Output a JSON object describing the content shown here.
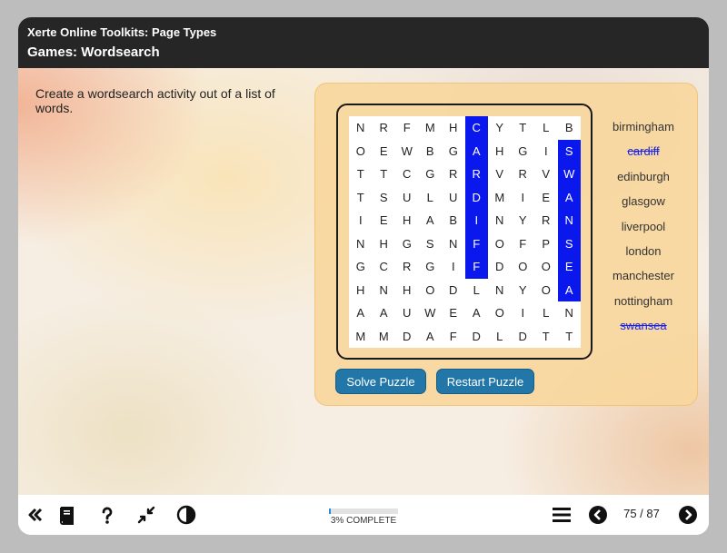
{
  "header": {
    "title": "Xerte Online Toolkits: Page Types",
    "subtitle": "Games: Wordsearch"
  },
  "intro": "Create a wordsearch activity out of a list of words.",
  "grid": [
    [
      "N",
      "R",
      "F",
      "M",
      "H",
      "C",
      "Y",
      "T",
      "L",
      "B"
    ],
    [
      "O",
      "E",
      "W",
      "B",
      "G",
      "A",
      "H",
      "G",
      "I",
      "S"
    ],
    [
      "T",
      "T",
      "C",
      "G",
      "R",
      "R",
      "V",
      "R",
      "V",
      "W"
    ],
    [
      "T",
      "S",
      "U",
      "L",
      "U",
      "D",
      "M",
      "I",
      "E",
      "A"
    ],
    [
      "I",
      "E",
      "H",
      "A",
      "B",
      "I",
      "N",
      "Y",
      "R",
      "N"
    ],
    [
      "N",
      "H",
      "G",
      "S",
      "N",
      "F",
      "O",
      "F",
      "P",
      "S"
    ],
    [
      "G",
      "C",
      "R",
      "G",
      "I",
      "F",
      "D",
      "O",
      "O",
      "E"
    ],
    [
      "H",
      "N",
      "H",
      "O",
      "D",
      "L",
      "N",
      "Y",
      "O",
      "A"
    ],
    [
      "A",
      "A",
      "U",
      "W",
      "E",
      "A",
      "O",
      "I",
      "L",
      "N"
    ],
    [
      "M",
      "M",
      "D",
      "A",
      "F",
      "D",
      "L",
      "D",
      "T",
      "T"
    ]
  ],
  "words": [
    {
      "text": "birmingham",
      "found": false
    },
    {
      "text": "cardiff",
      "found": true
    },
    {
      "text": "edinburgh",
      "found": false
    },
    {
      "text": "glasgow",
      "found": false
    },
    {
      "text": "liverpool",
      "found": false
    },
    {
      "text": "london",
      "found": false
    },
    {
      "text": "manchester",
      "found": false
    },
    {
      "text": "nottingham",
      "found": false
    },
    {
      "text": "swansea",
      "found": true
    }
  ],
  "found_letters": [
    {
      "word": "cardiff",
      "cells": [
        [
          0,
          5
        ],
        [
          1,
          5
        ],
        [
          2,
          5
        ],
        [
          3,
          5
        ],
        [
          4,
          5
        ],
        [
          5,
          5
        ],
        [
          6,
          5
        ]
      ]
    },
    {
      "word": "swansea",
      "cells": [
        [
          1,
          9
        ],
        [
          2,
          9
        ],
        [
          3,
          9
        ],
        [
          4,
          9
        ],
        [
          5,
          9
        ],
        [
          6,
          9
        ],
        [
          7,
          9
        ]
      ]
    }
  ],
  "buttons": {
    "solve": "Solve Puzzle",
    "restart": "Restart Puzzle"
  },
  "footer": {
    "progress_percent": 3,
    "progress_label": "3% COMPLETE",
    "page_count": "75 / 87",
    "icons": [
      "double-chevron-left-icon",
      "book-icon",
      "help-icon",
      "minimize-icon",
      "contrast-icon",
      "menu-icon",
      "previous-icon",
      "next-icon"
    ]
  },
  "colors": {
    "header_bg": "#262626",
    "highlight": "#0a18ee",
    "button": "#2277a8",
    "panel": "#f8d69b",
    "progress": "#2f8bd6"
  }
}
